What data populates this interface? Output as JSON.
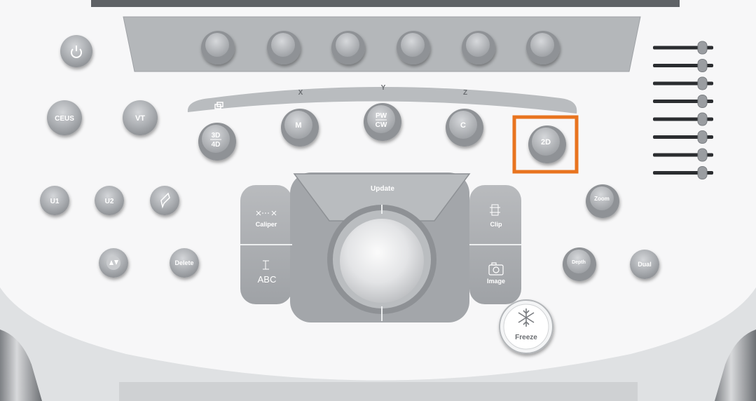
{
  "panel": {
    "axis_labels": [
      "X",
      "Y",
      "Z"
    ],
    "mode_buttons": {
      "ceus": "CEUS",
      "vt": "VT",
      "three_d_top": "3D",
      "three_d_bottom": "4D",
      "m": "M",
      "pw": "PW",
      "cw": "CW",
      "c": "C",
      "two_d": "2D"
    },
    "user_buttons": {
      "u1": "U1",
      "u2": "U2"
    },
    "utility": {
      "delete": "Delete",
      "zoom": "Zoom",
      "depth": "Depth",
      "dual": "Dual",
      "freeze": "Freeze"
    },
    "trackball_pad": {
      "update": "Update",
      "caliper": "Caliper",
      "abc": "ABC",
      "clip": "Clip",
      "image": "Image"
    },
    "tgc_slider_count": 8,
    "highlight_color": "#e8741f",
    "icons": [
      "power-icon",
      "pin-icon",
      "arrows-up-down-icon",
      "caliper-icon",
      "clip-icon",
      "camera-icon",
      "snowflake-icon",
      "layers-icon"
    ]
  }
}
